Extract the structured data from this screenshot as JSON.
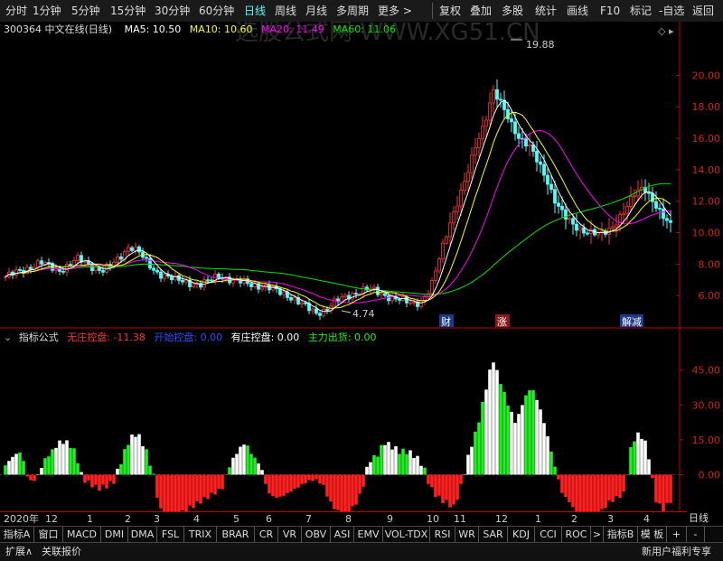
{
  "toolbar": {
    "period_items": [
      "分时",
      "1分钟",
      "5分钟",
      "15分钟",
      "30分钟",
      "60分钟",
      "日线",
      "周线",
      "月线",
      "多周期",
      "更多 >"
    ],
    "active_period": "日线",
    "right_items": [
      "复权",
      "叠加",
      "多股",
      "统计",
      "画线",
      "F10",
      "标记",
      "-自选",
      "返回"
    ]
  },
  "stock": {
    "code_name": "300364 中文在线(日线)",
    "ma5": "MA5: 10.50",
    "ma10": "MA10: 10.60",
    "ma20": "MA20: 11.49",
    "ma60": "MA60: 11.06",
    "high_label": "19.88",
    "low_label": "4.74",
    "markers": [
      "财",
      "涨",
      "解减"
    ],
    "watermark": "选股公式网 WWW.XG51.CN"
  },
  "indicator": {
    "name": "指标公式",
    "v1_label": "无庄控盘: -11.38",
    "v2_label": "开始控盘: 0.00",
    "v3_label": "有庄控盘: 0.00",
    "v4_label": "主力出货: 0.00"
  },
  "colors": {
    "up": "#ff3232",
    "down": "#54fcfc",
    "ma5": "#ffffff",
    "ma10": "#ffff00",
    "ma20": "#ff00ff",
    "ma60": "#00e600",
    "green_bar": "#22ee22",
    "white_bar": "#ffffff",
    "red_bar": "#ff2020",
    "axis": "#c00000"
  },
  "axes": {
    "price_ticks": [
      "20.00",
      "18.00",
      "16.00",
      "14.00",
      "12.00",
      "10.00",
      "8.00",
      "6.00"
    ],
    "ind_ticks": [
      "45.00",
      "30.00",
      "15.00",
      "0.00"
    ],
    "date_labels": [
      "2020年",
      "12",
      "1",
      "2",
      "3",
      "4",
      "5",
      "6",
      "7",
      "8",
      "9",
      "10",
      "11",
      "12",
      "1",
      "2",
      "3",
      "4"
    ],
    "period_label": "日线"
  },
  "tabs": [
    "指标A",
    "窗口",
    "MACD",
    "DMI",
    "DMA",
    "FSL",
    "TRIX",
    "BRAR",
    "CR",
    "VR",
    "OBV",
    "ASI",
    "EMV",
    "VOL-TDX",
    "RSI",
    "WR",
    "SAR",
    "KDJ",
    "CCI",
    "ROC",
    ">",
    "指标B",
    "模 板",
    "+",
    "-"
  ],
  "bottom": {
    "expand": "扩展∧",
    "related": "关联报价",
    "promo": "新用户福利专享"
  },
  "chart_data": [
    {
      "type": "candlestick",
      "title": "300364 中文在线(日线)",
      "ylim": [
        4,
        21
      ],
      "close_path": [
        7.2,
        7.4,
        7.6,
        7.9,
        8.1,
        7.8,
        7.6,
        7.9,
        8.3,
        8.1,
        7.8,
        7.6,
        7.9,
        8.5,
        9.2,
        8.8,
        8.0,
        7.5,
        7.3,
        7.0,
        6.9,
        6.8,
        6.7,
        6.9,
        7.3,
        7.1,
        6.9,
        6.8,
        6.7,
        6.6,
        6.4,
        6.2,
        6.0,
        5.6,
        5.2,
        4.9,
        5.1,
        5.5,
        5.8,
        6.1,
        6.3,
        6.4,
        6.2,
        6.0,
        5.8,
        5.6,
        5.5,
        5.7,
        6.5,
        8.5,
        10.5,
        12.0,
        13.5,
        15.5,
        17.0,
        19.0,
        18.0,
        17.0,
        16.0,
        15.5,
        14.5,
        13.5,
        12.0,
        11.0,
        10.5,
        10.2,
        10.0,
        9.8,
        10.2,
        10.8,
        11.5,
        12.5,
        13.0,
        12.0,
        11.0,
        10.5
      ],
      "series": [
        {
          "name": "MA5",
          "last": 10.5
        },
        {
          "name": "MA10",
          "last": 10.6
        },
        {
          "name": "MA20",
          "last": 11.49
        },
        {
          "name": "MA60",
          "last": 11.06
        }
      ],
      "annotations": [
        {
          "label": "19.88",
          "type": "high"
        },
        {
          "label": "4.74",
          "type": "low"
        }
      ]
    },
    {
      "type": "bar",
      "title": "指标公式",
      "ylim": [
        -15,
        55
      ],
      "series": [
        {
          "name": "无庄控盘",
          "color": "red",
          "last": -11.38
        },
        {
          "name": "开始控盘",
          "last": 0.0
        },
        {
          "name": "有庄控盘",
          "last": 0.0
        },
        {
          "name": "主力出货",
          "last": 0.0
        }
      ],
      "value_path": [
        4,
        8,
        10,
        -3,
        -2,
        6,
        10,
        14,
        14,
        10,
        -2,
        -4,
        -6,
        -5,
        -3,
        6,
        15,
        18,
        12,
        2,
        -15,
        -22,
        -20,
        -16,
        -14,
        -12,
        -10,
        -8,
        -6,
        4,
        10,
        14,
        8,
        4,
        -8,
        -10,
        -9,
        -7,
        -5,
        -3,
        -2,
        -4,
        -12,
        -16,
        -18,
        -14,
        -8,
        6,
        8,
        14,
        12,
        10,
        10,
        8,
        4,
        -6,
        -10,
        -12,
        -14,
        -4,
        10,
        20,
        35,
        50,
        40,
        30,
        22,
        32,
        38,
        30,
        18,
        4,
        -8,
        -12,
        -18,
        -25,
        -22,
        -16,
        -12,
        -10,
        -8,
        14,
        18,
        12,
        -10,
        -16,
        -11
      ]
    }
  ]
}
